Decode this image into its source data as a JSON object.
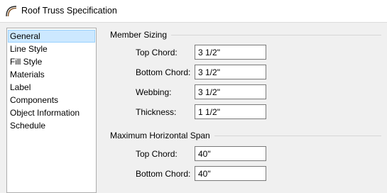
{
  "window": {
    "title": "Roof Truss Specification",
    "icon": "roof-arch-icon"
  },
  "sidebar": {
    "items": [
      {
        "label": "General",
        "selected": true
      },
      {
        "label": "Line Style",
        "selected": false
      },
      {
        "label": "Fill Style",
        "selected": false
      },
      {
        "label": "Materials",
        "selected": false
      },
      {
        "label": "Label",
        "selected": false
      },
      {
        "label": "Components",
        "selected": false
      },
      {
        "label": "Object Information",
        "selected": false
      },
      {
        "label": "Schedule",
        "selected": false
      }
    ]
  },
  "member_sizing": {
    "title": "Member Sizing",
    "top_chord": {
      "label": "Top Chord:",
      "value": "3 1/2\""
    },
    "bottom_chord": {
      "label": "Bottom Chord:",
      "value": "3 1/2\""
    },
    "webbing": {
      "label": "Webbing:",
      "value": "3 1/2\""
    },
    "thickness": {
      "label": "Thickness:",
      "value": "1 1/2\""
    }
  },
  "max_horizontal_span": {
    "title": "Maximum Horizontal Span",
    "top_chord": {
      "label": "Top Chord:",
      "value": "40\""
    },
    "bottom_chord": {
      "label": "Bottom Chord:",
      "value": "40\""
    }
  },
  "colors": {
    "selection_bg": "#cce8ff",
    "selection_border": "#99d1ff",
    "dialog_bg": "#f0f0f0"
  }
}
